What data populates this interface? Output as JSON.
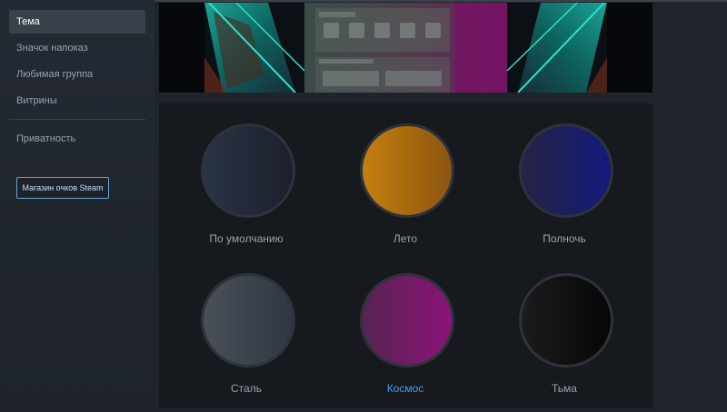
{
  "sidebar": {
    "items": [
      {
        "label": "Тема",
        "active": true
      },
      {
        "label": "Значок напоказ",
        "active": false
      },
      {
        "label": "Любимая группа",
        "active": false
      },
      {
        "label": "Витрины",
        "active": false
      },
      {
        "label": "Приватность",
        "active": false
      }
    ],
    "shop_button": "Магазин очков Steam"
  },
  "themes": [
    {
      "label": "По умолчанию",
      "colors": [
        "#2a3445",
        "#1c1f2d"
      ],
      "selected": false
    },
    {
      "label": "Лето",
      "colors": [
        "#c4800e",
        "#8c5410"
      ],
      "selected": false
    },
    {
      "label": "Полночь",
      "colors": [
        "#252443",
        "#131a7d"
      ],
      "selected": false
    },
    {
      "label": "Сталь",
      "colors": [
        "#4b5058",
        "#2f3741"
      ],
      "selected": false
    },
    {
      "label": "Космос",
      "colors": [
        "#57244f",
        "#8a137a"
      ],
      "selected": true
    },
    {
      "label": "Тьма",
      "colors": [
        "#1c1c1e",
        "#060606"
      ],
      "selected": false
    }
  ],
  "colors": {
    "accent": "#4c9de8",
    "panel": "#16191e",
    "sidebar_active": "#3b414a"
  }
}
